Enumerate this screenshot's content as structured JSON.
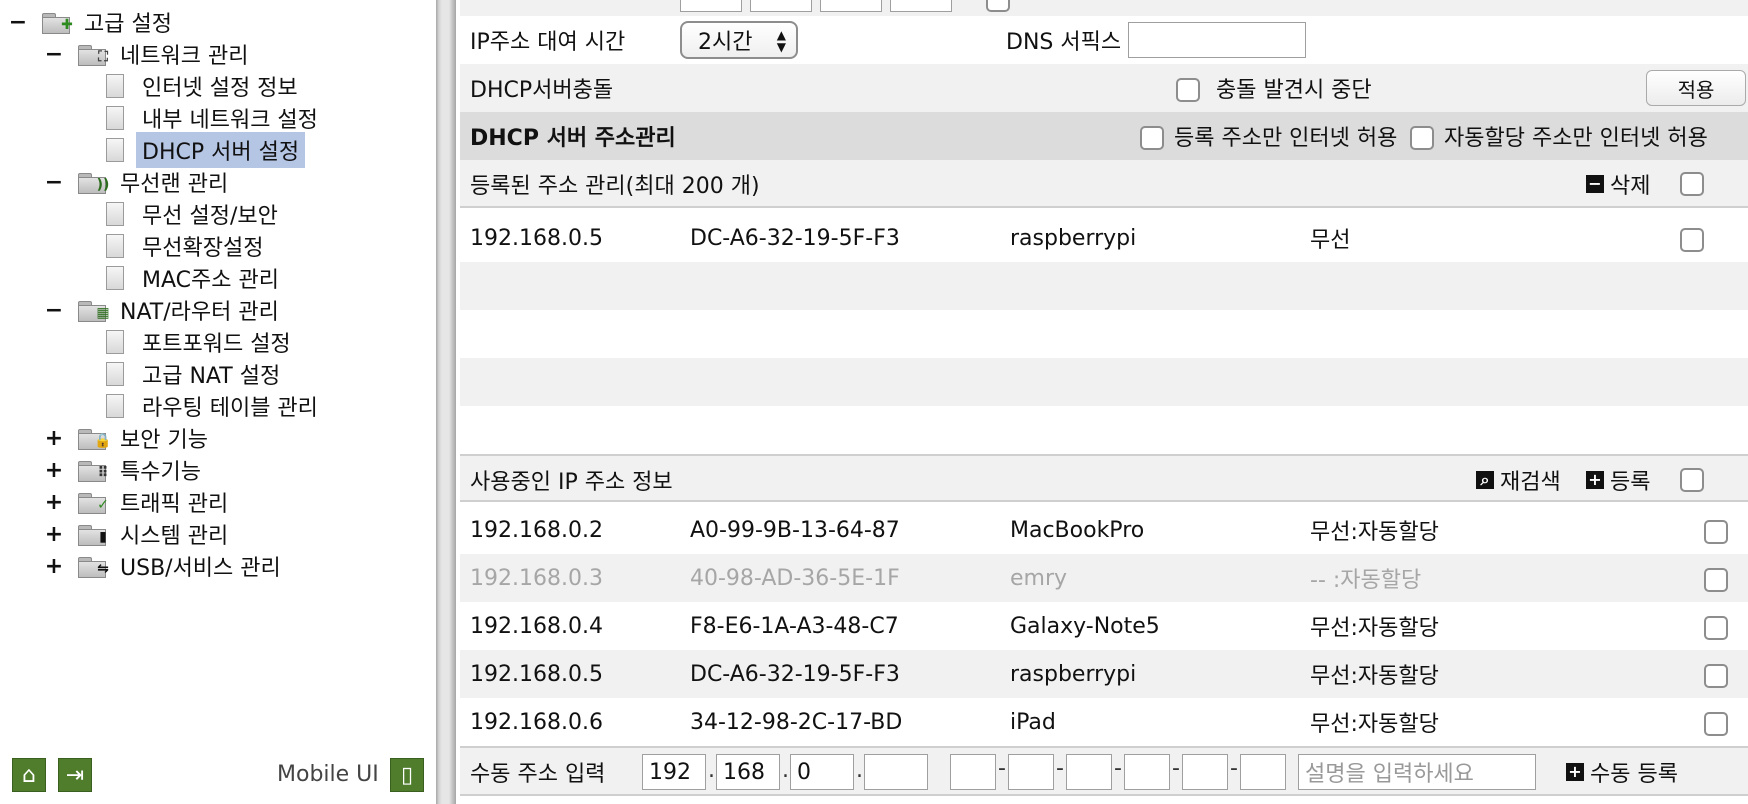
{
  "sidebar": {
    "root": {
      "label": "고급 설정",
      "toggle": "−"
    },
    "groups": [
      {
        "label": "네트워크 관리",
        "toggle": "−",
        "emblem": "⛶",
        "children": [
          "인터넷 설정 정보",
          "내부 네트워크 설정",
          "DHCP 서버 설정"
        ]
      },
      {
        "label": "무선랜 관리",
        "toggle": "−",
        "emblem": "))",
        "children": [
          "무선 설정/보안",
          "무선확장설정",
          "MAC주소 관리"
        ]
      },
      {
        "label": "NAT/라우터 관리",
        "toggle": "−",
        "emblem": "▦",
        "children": [
          "포트포워드 설정",
          "고급 NAT 설정",
          "라우팅 테이블 관리"
        ]
      },
      {
        "label": "보안 기능",
        "toggle": "+",
        "emblem": "🔒"
      },
      {
        "label": "특수기능",
        "toggle": "+",
        "emblem": "⠿"
      },
      {
        "label": "트래픽 관리",
        "toggle": "+",
        "emblem": "✓"
      },
      {
        "label": "시스템 관리",
        "toggle": "+",
        "emblem": "▮"
      },
      {
        "label": "USB/서비스 관리",
        "toggle": "+",
        "emblem": "⇋"
      }
    ],
    "selected": "DHCP 서버 설정",
    "footer": {
      "home_icon": "⌂",
      "logout_icon": "⇥",
      "mobile_label": "Mobile UI",
      "mobile_icon": "▯"
    }
  },
  "lease": {
    "label": "IP주소 대여 시간",
    "value": "2시간",
    "dns_label": "DNS 서픽스",
    "dns_value": ""
  },
  "conflict": {
    "label": "DHCP서버충돌",
    "stop_label": "충돌 발견시 중단",
    "apply": "적용"
  },
  "address_mgmt": {
    "title": "DHCP 서버 주소관리",
    "opt1": "등록 주소만 인터넷 허용",
    "opt2": "자동할당 주소만 인터넷 허용"
  },
  "registered": {
    "title": "등록된 주소 관리(최대 200 개)",
    "delete_label": "삭제",
    "rows": [
      {
        "ip": "192.168.0.5",
        "mac": "DC-A6-32-19-5F-F3",
        "name": "raspberrypi",
        "type": "무선"
      }
    ]
  },
  "in_use": {
    "title": "사용중인 IP 주소 정보",
    "rescan_label": "재검색",
    "register_label": "등록",
    "rows": [
      {
        "ip": "192.168.0.2",
        "mac": "A0-99-9B-13-64-87",
        "name": "MacBookPro",
        "type": "무선:자동할당",
        "dim": false
      },
      {
        "ip": "192.168.0.3",
        "mac": "40-98-AD-36-5E-1F",
        "name": "emry",
        "type": "-- :자동할당",
        "dim": true
      },
      {
        "ip": "192.168.0.4",
        "mac": "F8-E6-1A-A3-48-C7",
        "name": "Galaxy-Note5",
        "type": "무선:자동할당",
        "dim": false
      },
      {
        "ip": "192.168.0.5",
        "mac": "DC-A6-32-19-5F-F3",
        "name": "raspberrypi",
        "type": "무선:자동할당",
        "dim": false
      },
      {
        "ip": "192.168.0.6",
        "mac": "34-12-98-2C-17-BD",
        "name": "iPad",
        "type": "무선:자동할당",
        "dim": false
      }
    ]
  },
  "manual": {
    "label": "수동 주소 입력",
    "ip": [
      "192",
      "168",
      "0",
      ""
    ],
    "mac": [
      "",
      "",
      "",
      "",
      "",
      ""
    ],
    "desc_placeholder": "설명을 입력하세요",
    "register_label": "수동 등록"
  },
  "colors": {
    "selected_bg": "#b5c5e4",
    "header_bg": "#dcdcdc",
    "alt_bg": "#f1f1f1",
    "dim_text": "#a6a6a6"
  }
}
